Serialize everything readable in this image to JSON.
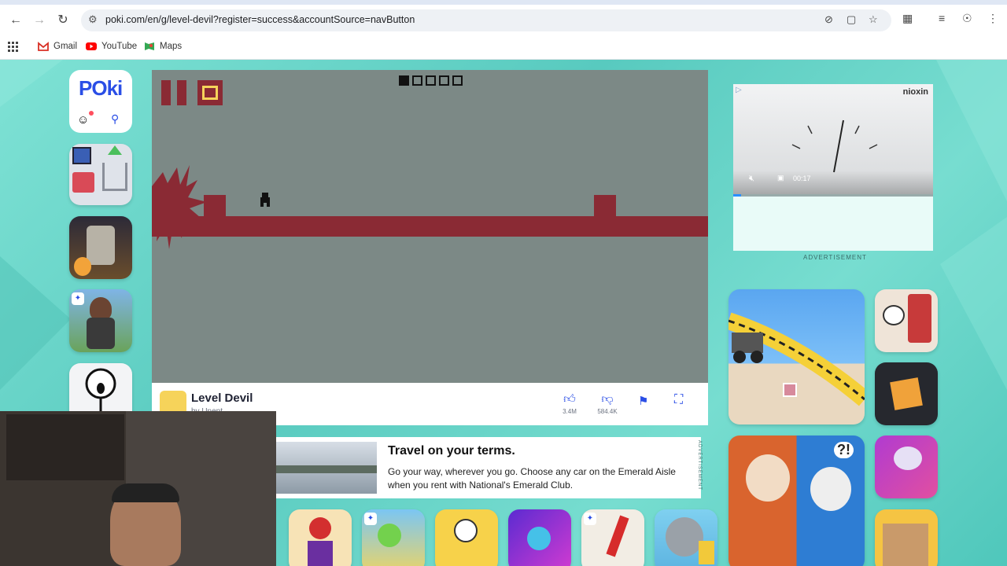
{
  "browser": {
    "url": "poki.com/en/g/level-devil?register=success&accountSource=navButton",
    "bookmarks": [
      {
        "label": "Gmail",
        "icon": "gmail-icon"
      },
      {
        "label": "YouTube",
        "icon": "youtube-icon"
      },
      {
        "label": "Maps",
        "icon": "maps-icon"
      }
    ]
  },
  "site": {
    "logo": "POki"
  },
  "game": {
    "title": "Level Devil",
    "developer": "by Unept",
    "likes": "3.4M",
    "dislikes": "584.4K",
    "level_progress": {
      "current": 1,
      "total": 5
    }
  },
  "ads": {
    "right_label": "ADVERTISEMENT",
    "video_time": "00:17",
    "video_brand": "nioxin",
    "banner_title": "Travel on your terms.",
    "banner_body": "Go your way, wherever you go. Choose any car on the Emerald Aisle when you rent with National's Emerald Club.",
    "banner_label": "ADVERTISEMENT"
  },
  "colors": {
    "accent": "#2a4ee6",
    "game_bg": "#7c8986",
    "game_red": "#8a2a34",
    "page_bg": "#5ed1c4"
  }
}
